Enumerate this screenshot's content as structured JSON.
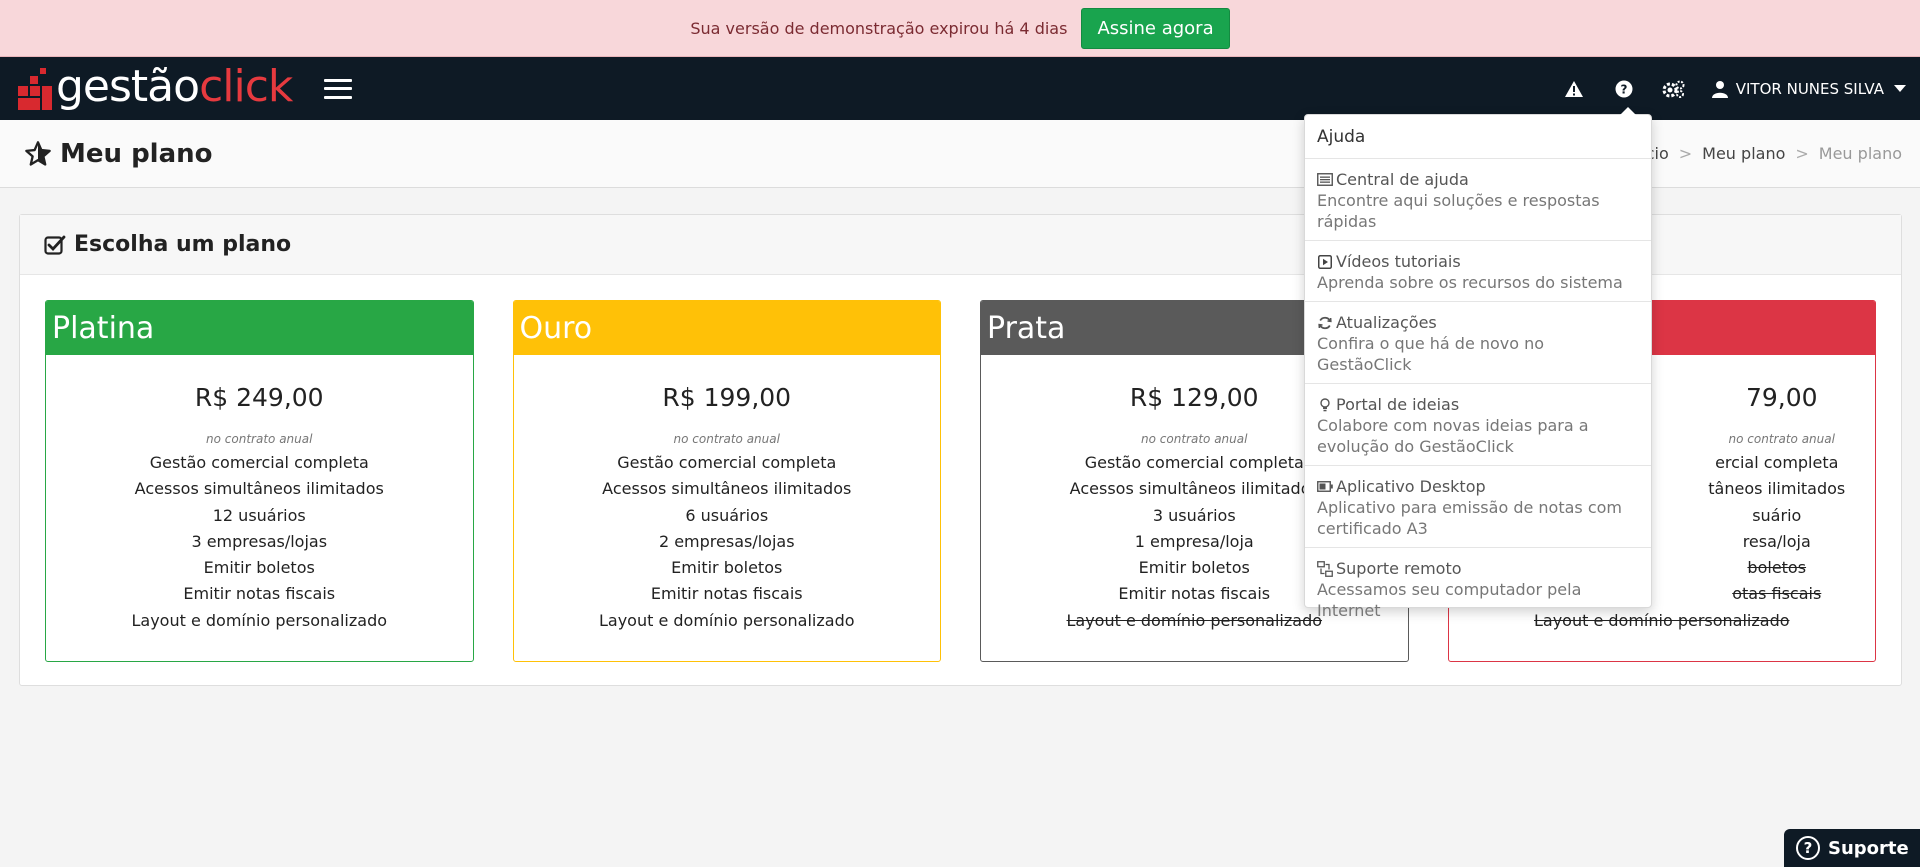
{
  "banner": {
    "text": "Sua versão de demonstração expirou há 4 dias",
    "button": "Assine agora"
  },
  "logo": {
    "part1": "gestão",
    "part2": "click"
  },
  "nav": {
    "icons": [
      "warning-icon",
      "help-icon",
      "settings-icon",
      "user-icon"
    ],
    "user_name": "VITOR NUNES SILVA"
  },
  "page": {
    "title": "Meu plano",
    "breadcrumb": [
      "Início",
      "Meu plano",
      "Meu plano"
    ]
  },
  "panel": {
    "title": "Escolha um plano"
  },
  "plans": [
    {
      "name": "Platina",
      "color": "#28a745",
      "price": "R$ 249,00",
      "note": "no contrato anual",
      "features": [
        {
          "text": "Gestão comercial completa",
          "included": true
        },
        {
          "text": "Acessos simultâneos ilimitados",
          "included": true
        },
        {
          "text": "12 usuários",
          "included": true
        },
        {
          "text": "3 empresas/lojas",
          "included": true
        },
        {
          "text": "Emitir boletos",
          "included": true
        },
        {
          "text": "Emitir notas fiscais",
          "included": true
        },
        {
          "text": "Layout e domínio personalizado",
          "included": true
        }
      ]
    },
    {
      "name": "Ouro",
      "color": "#ffc107",
      "price": "R$ 199,00",
      "note": "no contrato anual",
      "features": [
        {
          "text": "Gestão comercial completa",
          "included": true
        },
        {
          "text": "Acessos simultâneos ilimitados",
          "included": true
        },
        {
          "text": "6 usuários",
          "included": true
        },
        {
          "text": "2 empresas/lojas",
          "included": true
        },
        {
          "text": "Emitir boletos",
          "included": true
        },
        {
          "text": "Emitir notas fiscais",
          "included": true
        },
        {
          "text": "Layout e domínio personalizado",
          "included": true
        }
      ]
    },
    {
      "name": "Prata",
      "color": "#5a5a5a",
      "price": "R$ 129,00",
      "note": "no contrato anual",
      "features": [
        {
          "text": "Gestão comercial completa",
          "included": true
        },
        {
          "text": "Acessos simultâneos ilimitados",
          "included": true
        },
        {
          "text": "3 usuários",
          "included": true
        },
        {
          "text": "1 empresa/loja",
          "included": true
        },
        {
          "text": "Emitir boletos",
          "included": true
        },
        {
          "text": "Emitir notas fiscais",
          "included": true
        },
        {
          "text": "Layout e domínio personalizado",
          "included": false
        }
      ]
    },
    {
      "name": "",
      "color": "#dc3545",
      "price": "79,00",
      "note": "no contrato anual",
      "features": [
        {
          "text": "ercial completa",
          "included": true
        },
        {
          "text": "tâneos ilimitados",
          "included": true
        },
        {
          "text": "suário",
          "included": true
        },
        {
          "text": "resa/loja",
          "included": true
        },
        {
          "text": "boletos",
          "included": false
        },
        {
          "text": "otas fiscais",
          "included": false
        },
        {
          "text": "Layout e domínio personalizado",
          "included": false
        }
      ]
    }
  ],
  "help_menu": {
    "title": "Ajuda",
    "items": [
      {
        "icon": "list-icon",
        "title": "Central de ajuda",
        "desc": "Encontre aqui soluções e respostas rápidas"
      },
      {
        "icon": "play-icon",
        "title": "Vídeos tutoriais",
        "desc": "Aprenda sobre os recursos do sistema"
      },
      {
        "icon": "refresh-icon",
        "title": "Atualizações",
        "desc": "Confira o que há de novo no GestãoClick"
      },
      {
        "icon": "lightbulb-icon",
        "title": "Portal de ideias",
        "desc": "Colabore com novas ideias para a evolução do GestãoClick"
      },
      {
        "icon": "battery-icon",
        "title": "Aplicativo Desktop",
        "desc": "Aplicativo para emissão de notas com certificado A3"
      },
      {
        "icon": "remote-icon",
        "title": "Suporte remoto",
        "desc": "Acessamos seu computador pela Internet"
      }
    ]
  },
  "support": {
    "label": "Suporte"
  }
}
